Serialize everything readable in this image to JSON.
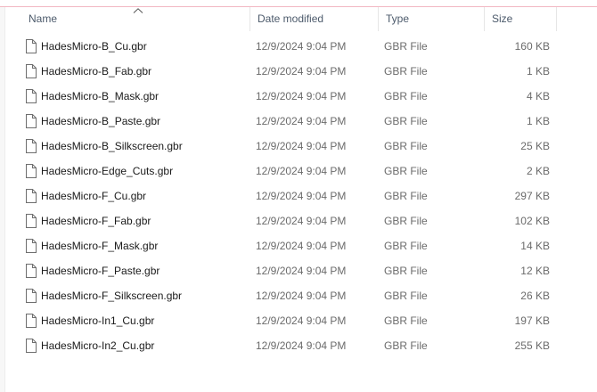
{
  "columns": {
    "name": "Name",
    "date": "Date modified",
    "type": "Type",
    "size": "Size",
    "sort_icon": "chevron-up-icon"
  },
  "files": [
    {
      "name": "HadesMicro-B_Cu.gbr",
      "date": "12/9/2024 9:04 PM",
      "type": "GBR File",
      "size": "160 KB",
      "icon": "file-icon"
    },
    {
      "name": "HadesMicro-B_Fab.gbr",
      "date": "12/9/2024 9:04 PM",
      "type": "GBR File",
      "size": "1 KB",
      "icon": "file-icon"
    },
    {
      "name": "HadesMicro-B_Mask.gbr",
      "date": "12/9/2024 9:04 PM",
      "type": "GBR File",
      "size": "4 KB",
      "icon": "file-icon"
    },
    {
      "name": "HadesMicro-B_Paste.gbr",
      "date": "12/9/2024 9:04 PM",
      "type": "GBR File",
      "size": "1 KB",
      "icon": "file-icon"
    },
    {
      "name": "HadesMicro-B_Silkscreen.gbr",
      "date": "12/9/2024 9:04 PM",
      "type": "GBR File",
      "size": "25 KB",
      "icon": "file-icon"
    },
    {
      "name": "HadesMicro-Edge_Cuts.gbr",
      "date": "12/9/2024 9:04 PM",
      "type": "GBR File",
      "size": "2 KB",
      "icon": "file-icon"
    },
    {
      "name": "HadesMicro-F_Cu.gbr",
      "date": "12/9/2024 9:04 PM",
      "type": "GBR File",
      "size": "297 KB",
      "icon": "file-icon"
    },
    {
      "name": "HadesMicro-F_Fab.gbr",
      "date": "12/9/2024 9:04 PM",
      "type": "GBR File",
      "size": "102 KB",
      "icon": "file-icon"
    },
    {
      "name": "HadesMicro-F_Mask.gbr",
      "date": "12/9/2024 9:04 PM",
      "type": "GBR File",
      "size": "14 KB",
      "icon": "file-icon"
    },
    {
      "name": "HadesMicro-F_Paste.gbr",
      "date": "12/9/2024 9:04 PM",
      "type": "GBR File",
      "size": "12 KB",
      "icon": "file-icon"
    },
    {
      "name": "HadesMicro-F_Silkscreen.gbr",
      "date": "12/9/2024 9:04 PM",
      "type": "GBR File",
      "size": "26 KB",
      "icon": "file-icon"
    },
    {
      "name": "HadesMicro-In1_Cu.gbr",
      "date": "12/9/2024 9:04 PM",
      "type": "GBR File",
      "size": "197 KB",
      "icon": "file-icon"
    },
    {
      "name": "HadesMicro-In2_Cu.gbr",
      "date": "12/9/2024 9:04 PM",
      "type": "GBR File",
      "size": "255 KB",
      "icon": "file-icon"
    }
  ],
  "colors": {
    "header_text": "#4c5a6b",
    "name_text": "#1a1a1a",
    "meta_text": "#6b6b6b",
    "accent_rule": "#f2b8c2"
  }
}
